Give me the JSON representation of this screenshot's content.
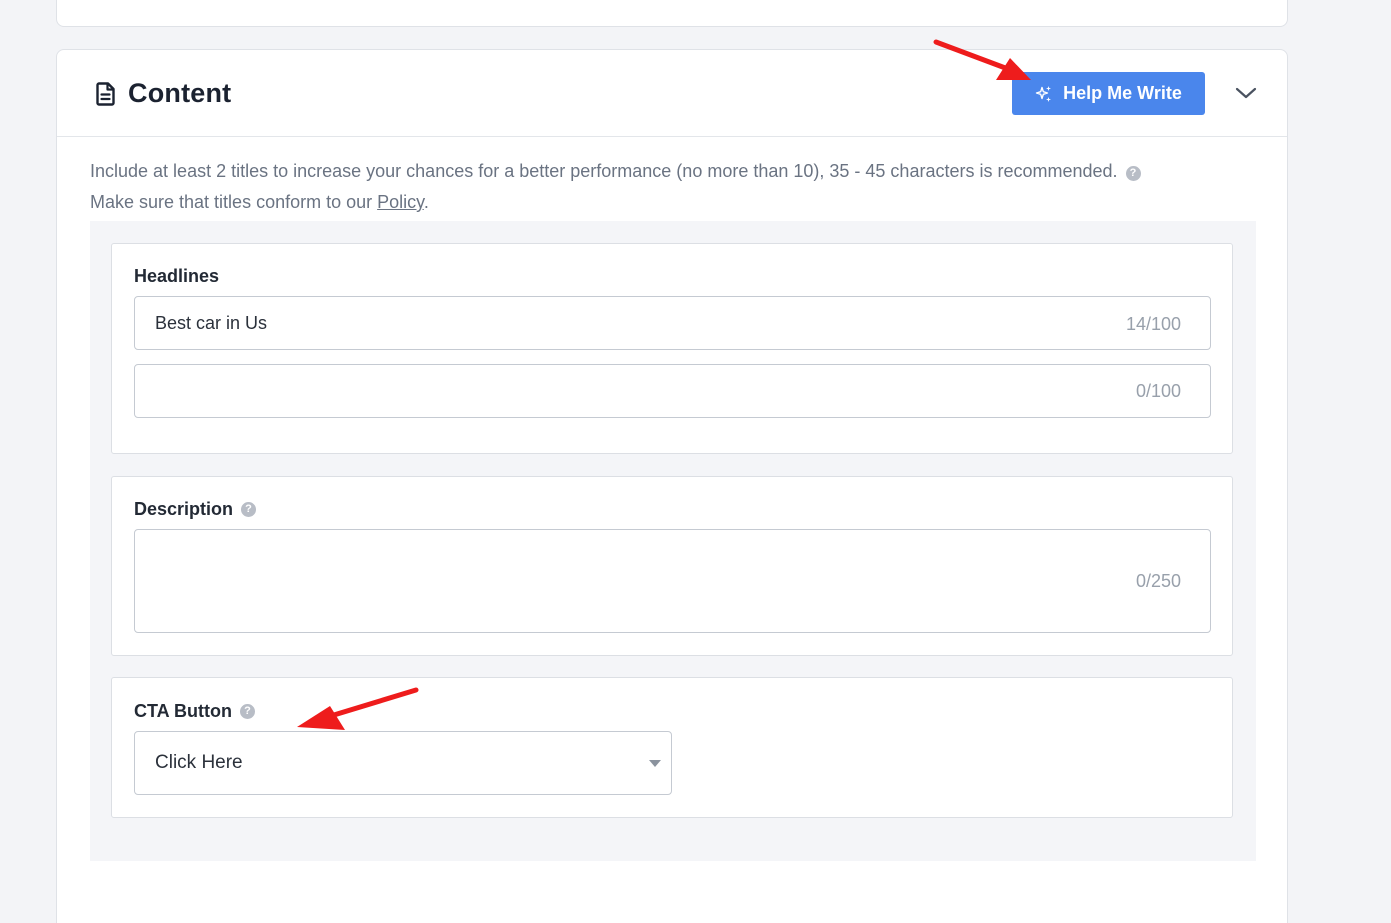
{
  "section": {
    "title": "Content",
    "help_button_label": "Help Me Write"
  },
  "intro": {
    "line1": "Include at least 2 titles to increase your chances for a better performance (no more than 10), 35 - 45 characters is recommended.",
    "line2_prefix": "Make sure that titles conform to our ",
    "policy_link": "Policy",
    "line2_suffix": "."
  },
  "headlines": {
    "label": "Headlines",
    "fields": [
      {
        "value": "Best car in Us",
        "counter": "14/100"
      },
      {
        "value": "",
        "counter": "0/100"
      }
    ]
  },
  "description": {
    "label": "Description",
    "value": "",
    "counter": "0/250"
  },
  "cta": {
    "label": "CTA Button",
    "selected": "Click Here"
  },
  "icons": {
    "section": "document-icon",
    "help_button": "sparkle-icon",
    "collapse": "chevron-down-icon",
    "help": "question-icon"
  },
  "colors": {
    "primary_button": "#4a86ec",
    "annotation_arrow": "#ee1c1c"
  }
}
